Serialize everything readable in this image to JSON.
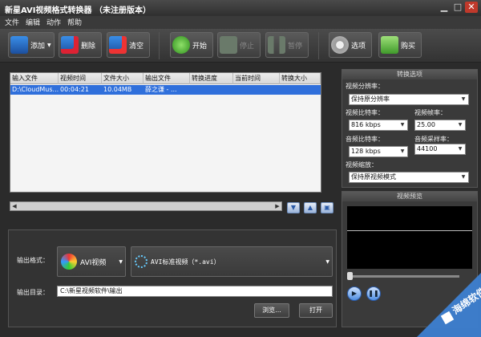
{
  "window": {
    "title": "新星AVI视频格式转换器 （未注册版本）"
  },
  "menu": [
    "文件",
    "编辑",
    "动作",
    "帮助"
  ],
  "toolbar": {
    "add": "添加",
    "delete": "删除",
    "clear": "清空",
    "start": "开始",
    "stop": "停止",
    "pause": "暂停",
    "options": "选项",
    "buy": "购买"
  },
  "file_list": {
    "columns": [
      "输入文件",
      "视频时间",
      "文件大小",
      "输出文件",
      "转换进度",
      "当前时间",
      "转换大小"
    ],
    "rows": [
      [
        "D:\\CloudMus...",
        "00:04:21",
        "10.04MB",
        "薛之谦 - ...",
        "",
        "",
        ""
      ]
    ]
  },
  "settings": {
    "title": "转换选项",
    "resolution_label": "视频分辨率：",
    "resolution_value": "保持原分辨率",
    "vbitrate_label": "视频比特率：",
    "vbitrate_value": "816 kbps",
    "framerate_label": "视频帧率：",
    "framerate_value": "25.00",
    "abitrate_label": "音频比特率：",
    "abitrate_value": "128 kbps",
    "samplerate_label": "音频采样率：",
    "samplerate_value": "44100",
    "scale_label": "视频缩放：",
    "scale_value": "保持原视频模式"
  },
  "preview": {
    "title": "视频预览"
  },
  "output": {
    "format_label": "输出格式：",
    "format_category": "AVI视频",
    "format_value": "AVI标准视频（*.avi）",
    "dir_label": "输出目录：",
    "dir_value": "C:\\新星视频软件\\输出",
    "browse": "浏览...",
    "open": "打开"
  },
  "watermark": {
    "text": "海绵软件"
  }
}
